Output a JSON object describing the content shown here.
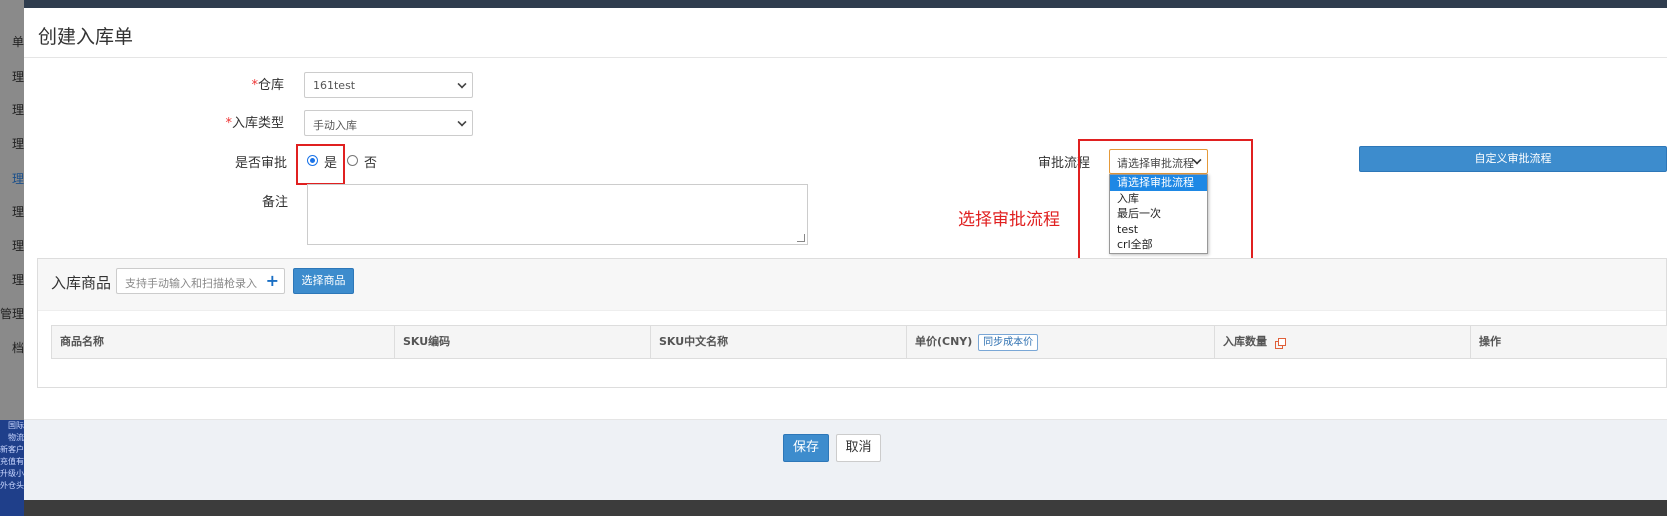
{
  "background": {
    "sidebar_items": [
      "单",
      "理",
      "理",
      "理",
      "理",
      "理",
      "理",
      "理",
      "管理",
      "档"
    ],
    "brand_lines": [
      "国际",
      "物流",
      "新客户",
      "充值有",
      "升级小",
      "外仓头程"
    ]
  },
  "modal": {
    "title": "创建入库单",
    "form": {
      "warehouse_label": "仓库",
      "warehouse_value": "161test",
      "inbound_type_label": "入库类型",
      "inbound_type_value": "手动入库",
      "approval_label": "是否审批",
      "approval_yes": "是",
      "approval_no": "否",
      "approval_selected": "是",
      "remark_label": "备注",
      "remark_value": "",
      "flow_label": "审批流程",
      "flow_selected": "请选择审批流程",
      "flow_options": [
        "请选择审批流程",
        "入库",
        "最后一次",
        "test",
        "crl全部"
      ],
      "custom_flow_button": "自定义审批流程",
      "annotation": "选择审批流程"
    },
    "goods": {
      "title": "入库商品",
      "scan_placeholder": "支持手动输入和扫描枪录入",
      "choose_button": "选择商品",
      "columns": [
        "商品名称",
        "SKU编码",
        "SKU中文名称",
        "单价(CNY)",
        "入库数量",
        "操作"
      ],
      "sync_cost_button": "同步成本价"
    },
    "footer": {
      "save_label": "保存",
      "cancel_label": "取消"
    }
  },
  "colors": {
    "primary": "#3d8ccd",
    "highlight_box": "#e02020",
    "required_mark": "#e33333",
    "dropdown_selected": "#1e88e5"
  }
}
